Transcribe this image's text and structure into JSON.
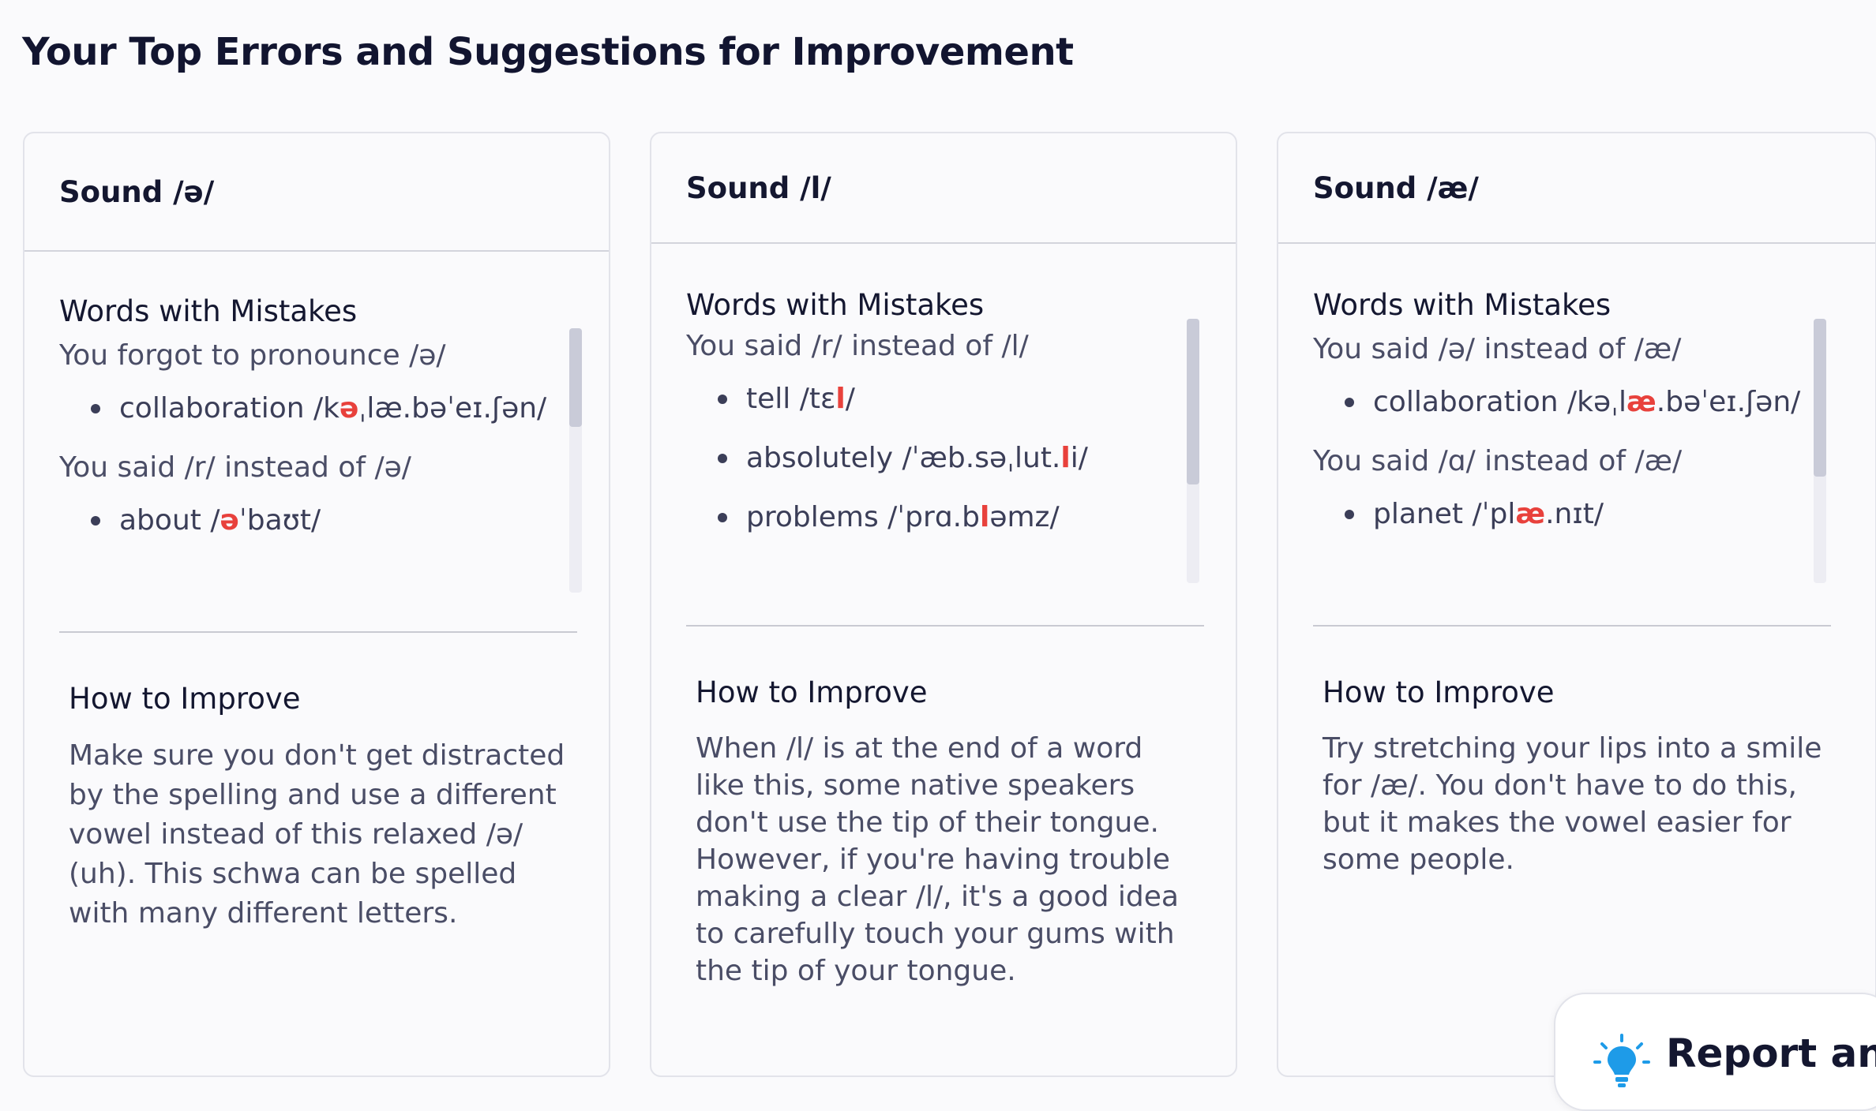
{
  "page": {
    "title": "Your Top Errors and Suggestions for Improvement"
  },
  "colors": {
    "highlight": "#e8413c",
    "text_dark": "#141730",
    "text_muted": "#4a4d66",
    "icon_blue": "#1e9be8"
  },
  "cards": [
    {
      "title": "Sound /ə/",
      "mistakes_title": "Words with Mistakes",
      "groups": [
        {
          "error": "You forgot to pronounce /ə/",
          "words": [
            {
              "pre": "collaboration /k",
              "hl": "ə",
              "post": "ˌlæ.bəˈeɪ.ʃən/"
            }
          ]
        },
        {
          "error": "You said /r/ instead of /ə/",
          "words": [
            {
              "pre": "about /",
              "hl": "ə",
              "post": "ˈbaʊt/"
            }
          ]
        }
      ],
      "improve_title": "How to Improve",
      "improve_text": "Make sure you don't get distracted by the spelling and use a different vowel instead of this relaxed /ə/ (uh). This schwa can be spelled with many different letters."
    },
    {
      "title": "Sound /l/",
      "mistakes_title": "Words with Mistakes",
      "groups": [
        {
          "error": "You said /r/ instead of /l/",
          "words": [
            {
              "pre": "tell /tɛ",
              "hl": "l",
              "post": "/"
            },
            {
              "pre": "absolutely /ˈæb.səˌlut.",
              "hl": "l",
              "post": "i/"
            },
            {
              "pre": "problems /ˈprɑ.b",
              "hl": "l",
              "post": "əmz/"
            }
          ]
        }
      ],
      "improve_title": "How to Improve",
      "improve_text": "When /l/ is at the end of a word like this, some native speakers don't use the tip of their tongue. However, if you're having trouble making a clear /l/, it's a good idea to carefully touch your gums with the tip of your tongue."
    },
    {
      "title": "Sound /æ/",
      "mistakes_title": "Words with Mistakes",
      "groups": [
        {
          "error": "You said /ə/ instead of /æ/",
          "words": [
            {
              "pre": "collaboration /kəˌl",
              "hl": "æ",
              "post": ".bəˈeɪ.ʃən/"
            }
          ]
        },
        {
          "error": "You said /ɑ/ instead of /æ/",
          "words": [
            {
              "pre": "planet /ˈpl",
              "hl": "æ",
              "post": ".nɪt/"
            }
          ]
        }
      ],
      "improve_title": "How to Improve",
      "improve_text": "Try stretching your lips into a smile for /æ/. You don't have to do this, but it makes the vowel easier for some people."
    }
  ],
  "report": {
    "label": "Report an Is",
    "icon": "lightbulb-icon"
  }
}
